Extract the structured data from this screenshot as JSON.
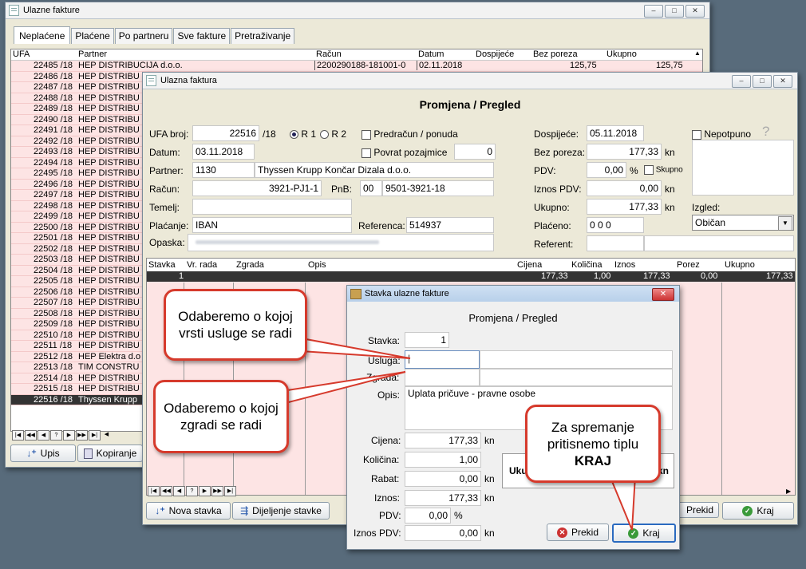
{
  "outer": {
    "title": "Ulazne fakture",
    "tabs": [
      "Neplaćene",
      "Plaćene",
      "Po partneru",
      "Sve fakture",
      "Pretraživanje"
    ],
    "columns": [
      "UFA",
      "Partner",
      "Račun",
      "Datum",
      "Dospijeće",
      "Bez poreza",
      "Ukupno"
    ],
    "first_row": {
      "ufa": "22485 /18",
      "partner": "HEP DISTRIBUCIJA d.o.o.",
      "racun": "2200290188-181001-0",
      "datum": "02.11.2018",
      "bez_poreza": "125,75",
      "ukupno": "125,75"
    },
    "rows": [
      {
        "ufa": "22486 /18",
        "partner": "HEP DISTRIBU"
      },
      {
        "ufa": "22487 /18",
        "partner": "HEP DISTRIBU"
      },
      {
        "ufa": "22488 /18",
        "partner": "HEP DISTRIBU"
      },
      {
        "ufa": "22489 /18",
        "partner": "HEP DISTRIBU"
      },
      {
        "ufa": "22490 /18",
        "partner": "HEP DISTRIBU"
      },
      {
        "ufa": "22491 /18",
        "partner": "HEP DISTRIBU"
      },
      {
        "ufa": "22492 /18",
        "partner": "HEP DISTRIBU"
      },
      {
        "ufa": "22493 /18",
        "partner": "HEP DISTRIBU"
      },
      {
        "ufa": "22494 /18",
        "partner": "HEP DISTRIBU"
      },
      {
        "ufa": "22495 /18",
        "partner": "HEP DISTRIBU"
      },
      {
        "ufa": "22496 /18",
        "partner": "HEP DISTRIBU"
      },
      {
        "ufa": "22497 /18",
        "partner": "HEP DISTRIBU"
      },
      {
        "ufa": "22498 /18",
        "partner": "HEP DISTRIBU"
      },
      {
        "ufa": "22499 /18",
        "partner": "HEP DISTRIBU"
      },
      {
        "ufa": "22500 /18",
        "partner": "HEP DISTRIBU"
      },
      {
        "ufa": "22501 /18",
        "partner": "HEP DISTRIBU"
      },
      {
        "ufa": "22502 /18",
        "partner": "HEP DISTRIBU"
      },
      {
        "ufa": "22503 /18",
        "partner": "HEP DISTRIBU"
      },
      {
        "ufa": "22504 /18",
        "partner": "HEP DISTRIBU"
      },
      {
        "ufa": "22505 /18",
        "partner": "HEP DISTRIBU"
      },
      {
        "ufa": "22506 /18",
        "partner": "HEP DISTRIBU"
      },
      {
        "ufa": "22507 /18",
        "partner": "HEP DISTRIBU"
      },
      {
        "ufa": "22508 /18",
        "partner": "HEP DISTRIBU"
      },
      {
        "ufa": "22509 /18",
        "partner": "HEP DISTRIBU"
      },
      {
        "ufa": "22510 /18",
        "partner": "HEP DISTRIBU"
      },
      {
        "ufa": "22511 /18",
        "partner": "HEP DISTRIBU"
      },
      {
        "ufa": "22512 /18",
        "partner": "HEP Elektra d.o"
      },
      {
        "ufa": "22513 /18",
        "partner": "TIM CONSTRU"
      },
      {
        "ufa": "22514 /18",
        "partner": "HEP DISTRIBU"
      },
      {
        "ufa": "22515 /18",
        "partner": "HEP DISTRIBU"
      }
    ],
    "selected_row": {
      "ufa": "22516 /18",
      "partner": "Thyssen Krupp"
    },
    "btn_upis": "Upis",
    "btn_kopiranje": "Kopiranje"
  },
  "invoice": {
    "title": "Ulazna faktura",
    "heading": "Promjena / Pregled",
    "ufa_label": "UFA broj:",
    "ufa_num": "22516",
    "ufa_year": "/18",
    "r1": "R 1",
    "r2": "R 2",
    "predracun_label": "Predračun / ponuda",
    "povrat_label": "Povrat pozajmice",
    "povrat_val": "0",
    "datum_label": "Datum:",
    "datum": "03.11.2018",
    "partner_label": "Partner:",
    "partner_code": "1130",
    "partner_name": "Thyssen Krupp Končar Dizala d.o.o.",
    "racun_label": "Račun:",
    "racun": "3921-PJ1-1",
    "pnb_label": "PnB:",
    "pnb_model": "00",
    "pnb": "9501-3921-18",
    "temelj_label": "Temelj:",
    "placanje_label": "Plaćanje:",
    "placanje": "IBAN",
    "referenca_label": "Referenca:",
    "referenca": "514937",
    "opaska_label": "Opaska:",
    "dospijece_label": "Dospijeće:",
    "dospijece": "05.11.2018",
    "bez_poreza_label": "Bez poreza:",
    "bez_poreza": "177,33",
    "kn": "kn",
    "pdv_label": "PDV:",
    "pdv": "0,00",
    "pct": "%",
    "skupno": "Skupno",
    "iznos_pdv_label": "Iznos PDV:",
    "iznos_pdv": "0,00",
    "ukupno_label": "Ukupno:",
    "ukupno": "177,33",
    "placeno_label": "Plaćeno:",
    "placeno": "0 0 0",
    "referent_label": "Referent:",
    "nepotpuno": "Nepotpuno",
    "help": "?",
    "izgled_label": "Izgled:",
    "izgled": "Običan",
    "items_columns": [
      "Stavka",
      "Vr. rada",
      "Zgrada",
      "Opis",
      "Cijena",
      "Količina",
      "Iznos",
      "Porez",
      "Ukupno"
    ],
    "item_row": {
      "stavka": "1",
      "cijena": "177,33",
      "kolicina": "1,00",
      "iznos": "177,33",
      "porez": "0,00",
      "ukupno": "177,33"
    },
    "btn_nova": "Nova stavka",
    "btn_dijeljenje": "Dijeljenje stavke",
    "btn_prekid": "Prekid",
    "btn_kraj": "Kraj"
  },
  "item": {
    "title": "Stavka ulazne fakture",
    "heading": "Promjena / Pregled",
    "stavka_label": "Stavka:",
    "stavka": "1",
    "usluga_label": "Usluga:",
    "zgrada_label": "Zgrada:",
    "opis_label": "Opis:",
    "opis": "Uplata pričuve - pravne osobe",
    "cijena_label": "Cijena:",
    "cijena": "177,33",
    "kolicina_label": "Količina:",
    "kolicina": "1,00",
    "rabat_label": "Rabat:",
    "rabat": "0,00",
    "iznos_label": "Iznos:",
    "iznos": "177,33",
    "pdv_label": "PDV:",
    "pdv": "0,00",
    "pct": "%",
    "iznos_pdv_label": "Iznos PDV:",
    "iznos_pdv": "0,00",
    "kn": "kn",
    "ukupno_partial": "Uku",
    "kn_partial": "kn",
    "btn_prekid": "Prekid",
    "btn_kraj": "Kraj"
  },
  "callouts": {
    "c1": "Odaberemo o kojoj vrsti usluge se radi",
    "c2": "Odaberemo o kojoj zgradi se radi",
    "c3_a": "Za spremanje pritisnemo tiplu",
    "c3_b": "KRAJ"
  },
  "colors": {
    "row_pink": "#fde4e4",
    "selected_row": "#333333",
    "callout_border": "#d63a2c"
  }
}
